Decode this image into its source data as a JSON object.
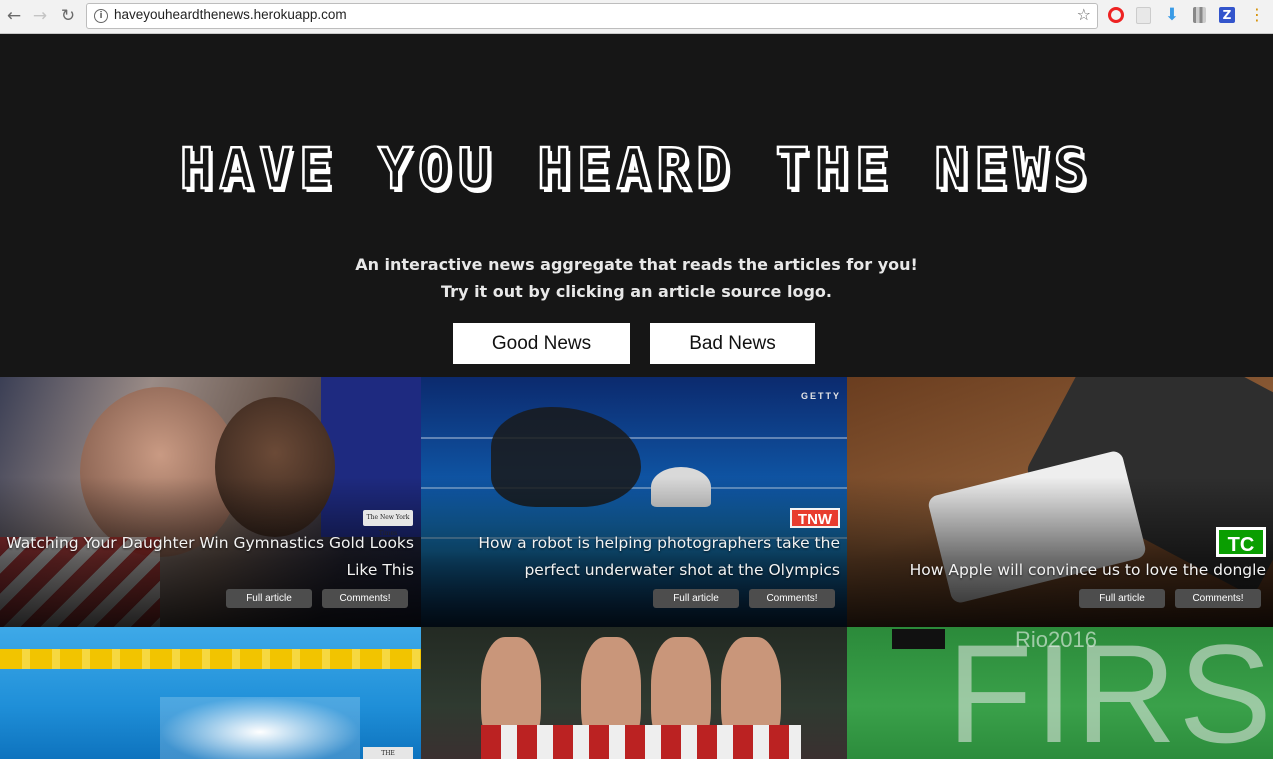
{
  "browser": {
    "url": "haveyouheardthenews.herokuapp.com",
    "back_icon": "←",
    "forward_icon": "→",
    "reload_icon": "↻",
    "info_icon": "i",
    "bookmark_icon": "☆",
    "download_icon": "⬇",
    "z_icon": "Z",
    "menu_icon": "⋮"
  },
  "hero": {
    "title": "HAVE YOU HEARD THE NEWS",
    "tagline_1": "An interactive news aggregate that reads the articles for you!",
    "tagline_2": "Try it out by clicking an article source logo.",
    "good_button": "Good News",
    "bad_button": "Bad News"
  },
  "articles": [
    {
      "headline": "Watching Your Daughter Win Gymnastics Gold Looks Like This",
      "source_logo": "The New York Times",
      "full_label": "Full article",
      "comments_label": "Comments!"
    },
    {
      "headline": "How a robot is helping photographers take the perfect underwater shot at the Olympics",
      "source_logo": "TNW",
      "photo_credit": "GETTY",
      "full_label": "Full article",
      "comments_label": "Comments!"
    },
    {
      "headline": "How Apple will convince us to love the dongle",
      "source_logo": "TC",
      "full_label": "Full article",
      "comments_label": "Comments!"
    },
    {
      "source_logo": "THE"
    },
    {},
    {
      "overlay_text": "FIRST",
      "scoreboard": "Rio2016"
    }
  ],
  "colors": {
    "page_bg": "#161616",
    "tnw_red": "#e83c2e",
    "tc_green": "#0a9e01"
  }
}
